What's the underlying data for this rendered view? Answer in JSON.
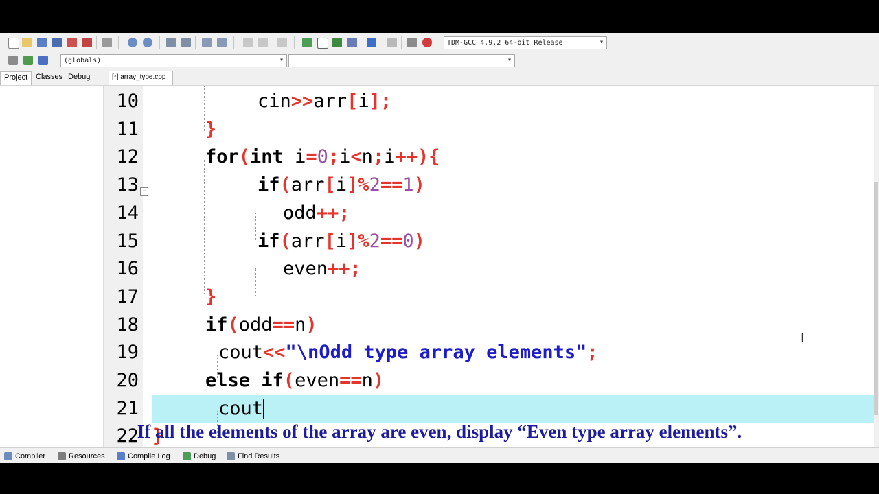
{
  "compiler_select": {
    "value": "TDM-GCC 4.9.2 64-bit Release"
  },
  "scope_select": {
    "value": "(globals)"
  },
  "symbol_select": {
    "value": ""
  },
  "panel_tabs": [
    {
      "label": "Project"
    },
    {
      "label": "Classes"
    },
    {
      "label": "Debug"
    }
  ],
  "file_tab": {
    "label": "[*] array_type.cpp"
  },
  "editor": {
    "line_numbers": [
      "10",
      "11",
      "12",
      "13",
      "14",
      "15",
      "16",
      "17",
      "18",
      "19",
      "20",
      "21",
      "22"
    ]
  },
  "caption": "If all the elements of the array are even, display “Even type array elements”.",
  "bottom_tabs": [
    {
      "label": "Compiler",
      "icon": "grid-icon"
    },
    {
      "label": "Resources",
      "icon": "resources-icon"
    },
    {
      "label": "Compile Log",
      "icon": "compile-log-icon"
    },
    {
      "label": "Debug",
      "icon": "debug-check-icon"
    },
    {
      "label": "Find Results",
      "icon": "find-icon"
    }
  ],
  "colors": {
    "keyword": "#000000",
    "operator": "#e8332b",
    "number": "#9c4fa8",
    "string": "#1c1cc8",
    "current_line": "#b9f1f7",
    "caption": "#1c1c9c"
  }
}
